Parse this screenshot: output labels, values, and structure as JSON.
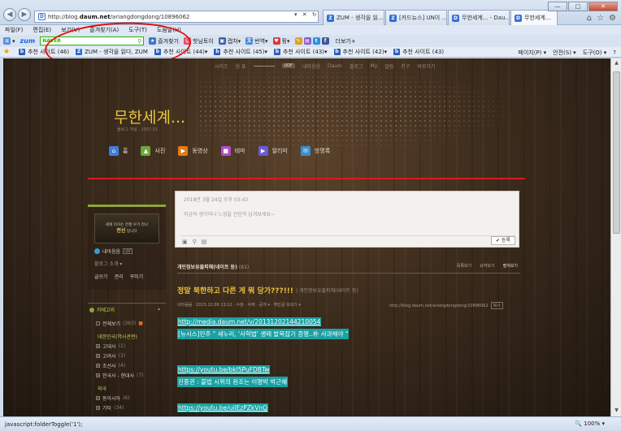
{
  "browser": {
    "back": "◀",
    "forward": "▶",
    "address_prefix": "http://blog.",
    "address_host": "daum.net",
    "address_path": "/ariangdongdong/10896062",
    "address_controls": "▾ ✕ ↻",
    "tabs": [
      {
        "icon": "Z",
        "color": "#2b6fd6",
        "label": "ZUM - 생각을 읽..."
      },
      {
        "icon": "Z",
        "color": "#2b6fd6",
        "label": "[카드뉴스] UN이 ..."
      },
      {
        "icon": "D",
        "color": "#3a6fd8",
        "label": "무한세계... - Dau..."
      },
      {
        "icon": "D",
        "color": "#3a6fd8",
        "label": "무한세계..."
      }
    ],
    "window_controls": {
      "minimize": "—",
      "maximize": "□",
      "close": "✕"
    },
    "tools_icons": [
      "⌂",
      "☆",
      "⚙"
    ],
    "menu": [
      "파일(F)",
      "편집(E)",
      "보기(V)",
      "즐겨찾기(A)",
      "도구(T)",
      "도움말(H)"
    ],
    "cmd": {
      "zum": "zum",
      "naver_label": "NAVER",
      "naver_value": "",
      "items": [
        "즐겨찾기",
        "핫님토이",
        "캡처",
        "번역",
        "핑",
        "",
        "",
        "",
        "",
        "더보기+"
      ]
    },
    "favorites": [
      "추천 사이트 (46)",
      "ZUM - 생각을 읽다, ZUM",
      "추천 사이트 (44)",
      "추천 사이트 (45)",
      "추천 사이트 (43)",
      "추천 사이트 (42)",
      "추천 사이트 (43)"
    ],
    "fav_right": [
      "페이지(P) ▾",
      "안전(S) ▾",
      "도구(O) ▾",
      "?"
    ],
    "status_text": "javascript:folderToggle('1');",
    "zoom": "🔍 100%  ▾"
  },
  "blog": {
    "daum_bar": [
      "시리즈",
      "음 표",
      "",
      "UDF",
      "내마음음",
      "Daum",
      "블로그",
      "My",
      "알림",
      "친구",
      "바로가기"
    ],
    "title": "무한세계...",
    "subtitle": "블로그 개설 : 2007.01",
    "nav": [
      {
        "label": "홈",
        "icon": "⌂",
        "color": "#3d7ed8"
      },
      {
        "label": "사진",
        "icon": "▲",
        "color": "#6aa83a"
      },
      {
        "label": "동영상",
        "icon": "▶",
        "color": "#e07a1a"
      },
      {
        "label": "테마",
        "icon": "■",
        "color": "#b24ec7"
      },
      {
        "label": "알리미",
        "icon": "▶",
        "color": "#6b5bd6"
      },
      {
        "label": "방명록",
        "icon": "✉",
        "color": "#3a8fd0"
      }
    ],
    "profile": {
      "image_text": "세계 이하는 전쟁 우기 라나",
      "image_text2": "전신",
      "image_text3": "입니다",
      "name": "내마음음",
      "badge": "UDF",
      "intro": "블로그 소개 ▾",
      "links": [
        "글쓰기",
        "관리",
        "꾸미기"
      ]
    },
    "categories": {
      "header": "카테고리",
      "items": [
        {
          "label": "전체보기",
          "count": "(363)"
        },
        {
          "label": "대한민국(역사관련)",
          "count": ""
        },
        {
          "label": "고대사",
          "count": "(1)"
        },
        {
          "label": "고려사",
          "count": "(3)"
        },
        {
          "label": "조선사",
          "count": "(4)"
        },
        {
          "label": "한국사 - 현대사",
          "count": "(7)"
        },
        {
          "label": "외국",
          "count": ""
        },
        {
          "label": "동아시아",
          "count": "(6)"
        },
        {
          "label": "기타",
          "count": "(34)"
        }
      ]
    },
    "write": {
      "date": "2018년 3월 24일 오후 03:43",
      "placeholder": "지금의 생각이나 느낌을 간단히 남겨보세요~",
      "submit": "✔ 등록",
      "tools": [
        "▣",
        "⚲",
        "▤"
      ]
    },
    "category_title": "개인정보유출피해(네이트 등)",
    "category_count": "(61)",
    "category_links": [
      "목록보기",
      "요약보기",
      "펼쳐보기"
    ],
    "post": {
      "title": "정말 북한하고 다른 게 뭐 당가???!!!",
      "category": "개인정보유출피해(네이트 등)",
      "meta": "내마음음 · 2015.12.06 13:12 · 수정 · 삭제 · 공개 ▾ · 엮인글 보내기 ▾",
      "url": "http://blog.daum.net/ariangdongdong/10896062",
      "url_btn": "복사",
      "lines": [
        "http://media.daum.net/v/20131202144210054",
        "[뉴시스]민주 \" 새누리, '사학법' 생떼 발목잡기 증명..朴 사과해야 \"",
        "https://youtu.be/bkl5PuFDBTw",
        "진중권 : 불법 시위의 원조는 이명박 박근혜",
        "https://youtu.be/uilEzPZkVnQ"
      ]
    }
  }
}
